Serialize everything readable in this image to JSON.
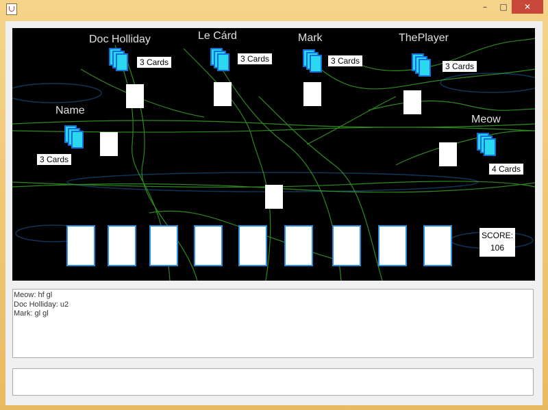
{
  "window": {
    "title": ""
  },
  "players": [
    {
      "name": "Doc Holliday",
      "cards": "3 Cards"
    },
    {
      "name": "Le Cárd",
      "cards": "3 Cards"
    },
    {
      "name": "Mark",
      "cards": "3 Cards"
    },
    {
      "name": "ThePlayer",
      "cards": "3 Cards"
    },
    {
      "name": "Name",
      "cards": "3 Cards"
    },
    {
      "name": "Meow",
      "cards": "4 Cards"
    }
  ],
  "hand": {
    "card_count": 9
  },
  "score": {
    "label": "SCORE:",
    "value": "106"
  },
  "chat": {
    "messages": [
      "Meow: hf gl",
      "Doc Holliday: u2",
      "Mark: gl gl"
    ],
    "input_value": ""
  },
  "colors": {
    "card_back": "#2bd8f0",
    "card_border": "#1470d8",
    "hand_border": "#2a8ee0",
    "background": "#000000"
  }
}
